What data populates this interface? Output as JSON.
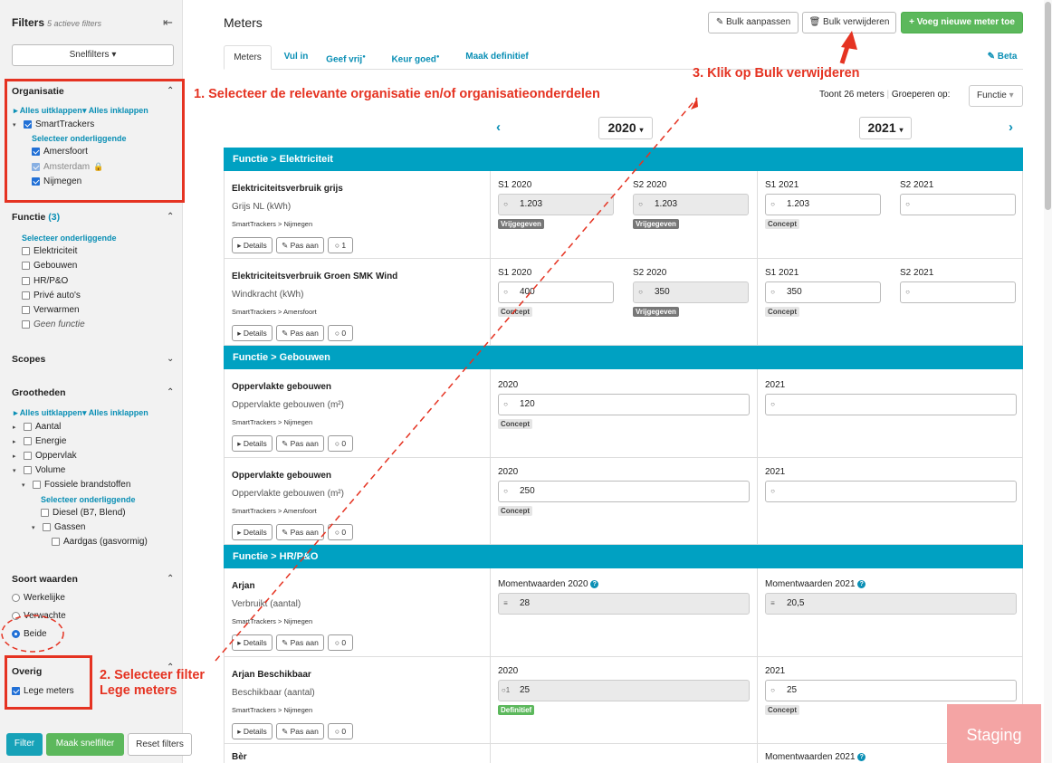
{
  "sidebar": {
    "title": "Filters",
    "subtitle": "5 actieve filters",
    "snelfilters_label": "Snelfilters",
    "organisatie": {
      "title": "Organisatie",
      "expand_all": "Alles uitklappen",
      "collapse_all": "Alles inklappen",
      "root": "SmartTrackers",
      "select_children": "Selecteer onderliggende",
      "children": [
        "Amersfoort",
        "Amsterdam",
        "Nijmegen"
      ]
    },
    "functie": {
      "title": "Functie",
      "count": "(3)",
      "select_children": "Selecteer onderliggende",
      "items": [
        "Elektriciteit",
        "Gebouwen",
        "HR/P&O",
        "Privé auto's",
        "Verwarmen",
        "Geen functie"
      ]
    },
    "scopes": {
      "title": "Scopes"
    },
    "grootheden": {
      "title": "Grootheden",
      "expand_all": "Alles uitklappen",
      "collapse_all": "Alles inklappen",
      "items": [
        "Aantal",
        "Energie",
        "Oppervlak",
        "Volume",
        "Fossiele brandstoffen",
        "Selecteer onderliggende",
        "Diesel (B7, Blend)",
        "Gassen",
        "Aardgas (gasvormig)"
      ]
    },
    "soort_waarden": {
      "title": "Soort waarden",
      "options": [
        "Werkelijke",
        "Verwachte",
        "Beide"
      ],
      "selected": "Beide"
    },
    "overig": {
      "title": "Overig",
      "lege_meters": "Lege meters"
    },
    "buttons": {
      "filter": "Filter",
      "maak": "Maak snelfilter",
      "reset": "Reset filters"
    }
  },
  "annotations": {
    "a1": "1. Selecteer de relevante organisatie en/of organisatieonderdelen",
    "a2_line1": "2. Selecteer filter",
    "a2_line2": "Lege meters",
    "a3": "3. Klik op Bulk verwijderen"
  },
  "header": {
    "title": "Meters",
    "bulk_edit": "Bulk aanpassen",
    "bulk_delete": "Bulk verwijderen",
    "add_meter": "Voeg nieuwe meter toe"
  },
  "tabs": [
    "Meters",
    "Vul in",
    "Geef vrij",
    "Keur goed",
    "Maak definitief"
  ],
  "beta_label": "Beta",
  "toolbar": {
    "count_text": "Toont 26 meters",
    "group_label": "Groeperen op:",
    "group_value": "Functie"
  },
  "years": {
    "left": "2020",
    "right": "2021"
  },
  "groups": {
    "elektriciteit": "Functie > Elektriciteit",
    "gebouwen": "Functie > Gebouwen",
    "hrpo": "Functie > HR/P&O"
  },
  "actions": {
    "details": "Details",
    "pas_aan": "Pas aan"
  },
  "meters": [
    {
      "name": "Elektriciteitsverbruik grijs",
      "unit": "Grijs NL (kWh)",
      "org": "SmartTrackers > Nijmegen",
      "comments": "1",
      "cells": [
        {
          "label": "S1 2020",
          "value": "1.203",
          "status": "Vrijgegeven"
        },
        {
          "label": "S2 2020",
          "value": "1.203",
          "status": "Vrijgegeven"
        },
        {
          "label": "S1 2021",
          "value": "1.203",
          "status": "Concept"
        },
        {
          "label": "S2 2021",
          "value": "",
          "status": ""
        }
      ]
    },
    {
      "name": "Elektriciteitsverbruik Groen SMK Wind",
      "unit": "Windkracht (kWh)",
      "org": "SmartTrackers > Amersfoort",
      "comments": "0",
      "cells": [
        {
          "label": "S1 2020",
          "value": "400",
          "status": "Concept"
        },
        {
          "label": "S2 2020",
          "value": "350",
          "status": "Vrijgegeven"
        },
        {
          "label": "S1 2021",
          "value": "350",
          "status": "Concept"
        },
        {
          "label": "S2 2021",
          "value": "",
          "status": ""
        }
      ]
    },
    {
      "name": "Oppervlakte gebouwen",
      "unit": "Oppervlakte gebouwen (m²)",
      "org": "SmartTrackers > Nijmegen",
      "comments": "0",
      "cells": [
        {
          "label": "2020",
          "value": "120",
          "status": "Concept"
        },
        {
          "label": "2021",
          "value": "",
          "status": ""
        }
      ]
    },
    {
      "name": "Oppervlakte gebouwen",
      "unit": "Oppervlakte gebouwen (m²)",
      "org": "SmartTrackers > Amersfoort",
      "comments": "0",
      "cells": [
        {
          "label": "2020",
          "value": "250",
          "status": "Concept"
        },
        {
          "label": "2021",
          "value": "",
          "status": ""
        }
      ]
    },
    {
      "name": "Arjan",
      "unit": "Verbruikt (aantal)",
      "org": "SmartTrackers > Nijmegen",
      "comments": "0",
      "cells": [
        {
          "label": "Momentwaarden 2020",
          "value": "28",
          "status": ""
        },
        {
          "label": "Momentwaarden 2021",
          "value": "20,5",
          "status": ""
        }
      ]
    },
    {
      "name": "Arjan Beschikbaar",
      "unit": "Beschikbaar (aantal)",
      "org": "SmartTrackers > Nijmegen",
      "comments": "0",
      "cells": [
        {
          "label": "2020",
          "value": "25",
          "status": "Definitief",
          "prefix": "1"
        },
        {
          "label": "2021",
          "value": "25",
          "status": "Concept"
        }
      ]
    },
    {
      "name": "Bèr",
      "cells": [
        {
          "label": "Momentwaarden 2021"
        }
      ]
    }
  ],
  "staging_label": "Staging",
  "colors": {
    "accent": "#00a1c2",
    "annotation": "#e53322",
    "primary_button": "#5cb85c",
    "filter_button": "#17a2b8"
  }
}
